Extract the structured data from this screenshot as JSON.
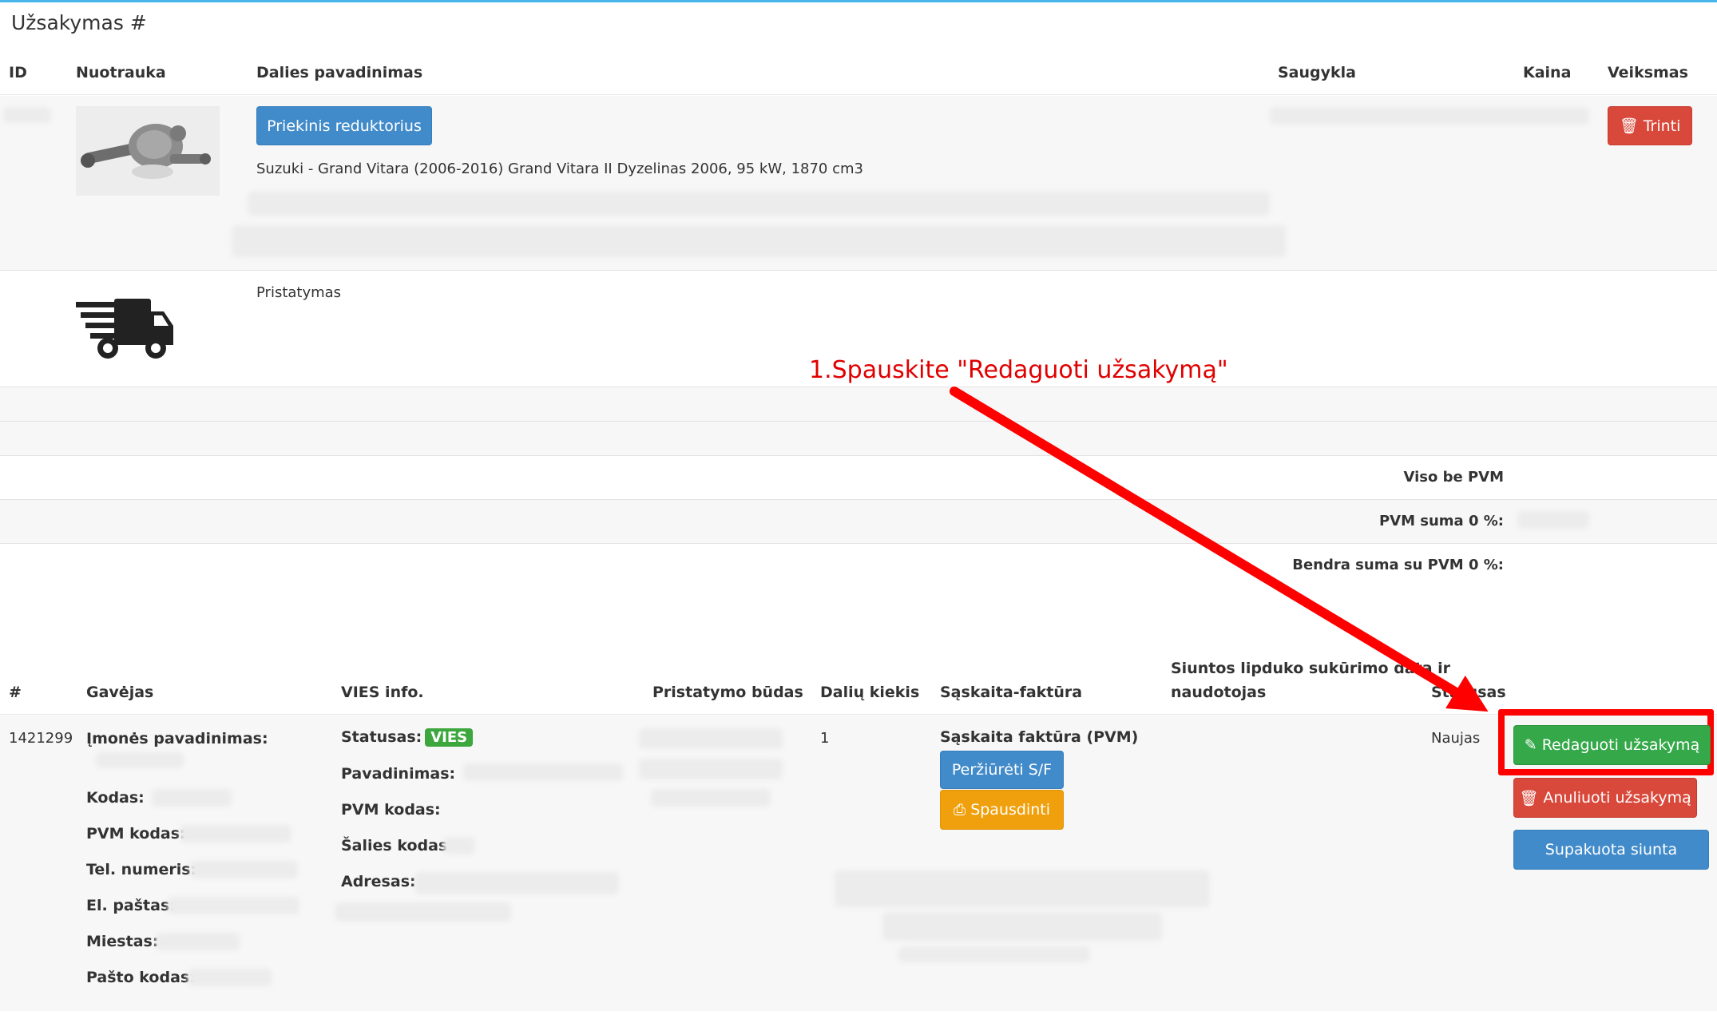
{
  "panel": {
    "title": "Užsakymas #"
  },
  "items_table": {
    "headers": {
      "id": "ID",
      "photo": "Nuotrauka",
      "name": "Dalies pavadinimas",
      "storage": "Saugykla",
      "price": "Kaina",
      "action": "Veiksmas"
    },
    "row": {
      "part_button": "Priekinis reduktorius",
      "description": "Suzuki - Grand Vitara (2006-2016) Grand Vitara II Dyzelinas 2006, 95 kW, 1870 cm3",
      "delete_button": "Trinti",
      "photo_icon": "transfer-case-photo"
    },
    "delivery": {
      "icon": "delivery-truck-icon",
      "label": "Pristatymas"
    }
  },
  "totals": {
    "without_vat": "Viso be PVM",
    "vat_sum": "PVM suma 0 %:",
    "total_with_vat": "Bendra suma su PVM 0 %:"
  },
  "annotation": {
    "text": "1.Spauskite \"Redaguoti užsakymą\"",
    "color": "#e00000"
  },
  "orders_table": {
    "headers": {
      "num": "#",
      "recipient": "Gavėjas",
      "vies": "VIES info.",
      "delivery": "Pristatymo būdas",
      "qty": "Dalių kiekis",
      "invoice": "Sąskaita-faktūra",
      "label_line1": "Siuntos lipduko sukūrimo data ir",
      "label_line2": "naudotojas",
      "status": "Statusas"
    },
    "row": {
      "num": "1421299",
      "recipient_fields": [
        "Įmonės pavadinimas:",
        "Kodas:",
        "PVM kodas:",
        "Tel. numeris:",
        "El. paštas:",
        "Miestas:",
        "Pašto kodas:"
      ],
      "vies_status_label": "Statusas:",
      "vies_badge": "VIES",
      "vies_fields": [
        "Pavadinimas:",
        "PVM kodas:",
        "Šalies kodas:",
        "Adresas:"
      ],
      "qty": "1",
      "invoice_title": "Sąskaita faktūra (PVM)",
      "view_invoice_button": "Peržiūrėti S/F",
      "print_button": "Spausdinti",
      "status_value": "Naujas",
      "edit_button": "Redaguoti užsakymą",
      "cancel_button": "Anuliuoti užsakymą",
      "packed_button": "Supakuota siunta"
    }
  },
  "colors": {
    "accent_line": "#49b4e8",
    "primary": "#428bca",
    "danger": "#d9493b",
    "success": "#35a94a",
    "warning": "#f0a00c",
    "highlight": "#ff0000"
  }
}
